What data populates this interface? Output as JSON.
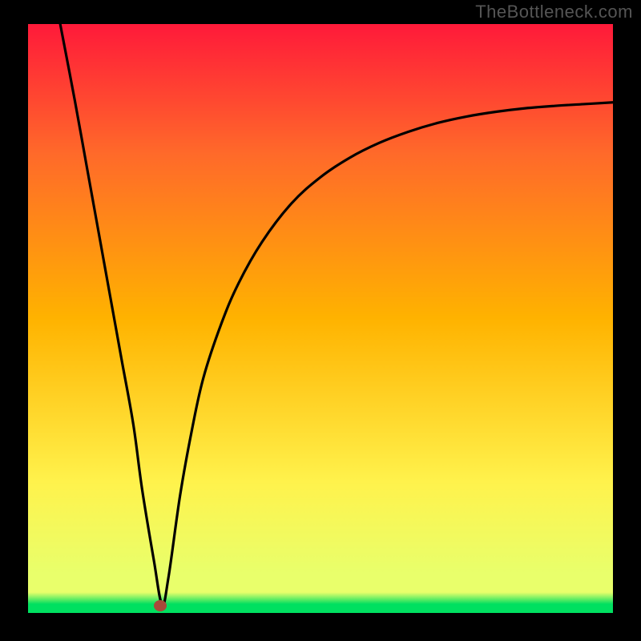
{
  "watermark": "TheBottleneck.com",
  "chart_data": {
    "type": "line",
    "title": "",
    "xlabel": "",
    "ylabel": "",
    "xlim": [
      0,
      100
    ],
    "ylim": [
      0,
      100
    ],
    "grid": false,
    "legend": false,
    "background_gradient": [
      "#ff1a3a",
      "#ff6a2a",
      "#ffb300",
      "#fff34d",
      "#e9ff6b",
      "#00e060"
    ],
    "series": [
      {
        "name": "curve",
        "x": [
          5.5,
          8,
          10,
          12,
          14,
          16,
          18,
          19.5,
          21.5,
          22.9,
          24,
          26,
          28,
          30,
          33,
          36,
          40,
          45,
          50,
          55,
          60,
          65,
          70,
          75,
          80,
          85,
          90,
          95,
          100
        ],
        "values": [
          100,
          87,
          76,
          65,
          54,
          43,
          32,
          21,
          9,
          1.5,
          6,
          20,
          31,
          40,
          49,
          56,
          63,
          69.5,
          74,
          77.3,
          79.8,
          81.7,
          83.2,
          84.3,
          85.1,
          85.7,
          86.1,
          86.4,
          86.7
        ]
      }
    ],
    "annotations": [
      {
        "name": "minimum-marker",
        "x": 22.6,
        "y": 1.2,
        "color": "#a94a3a"
      }
    ]
  }
}
